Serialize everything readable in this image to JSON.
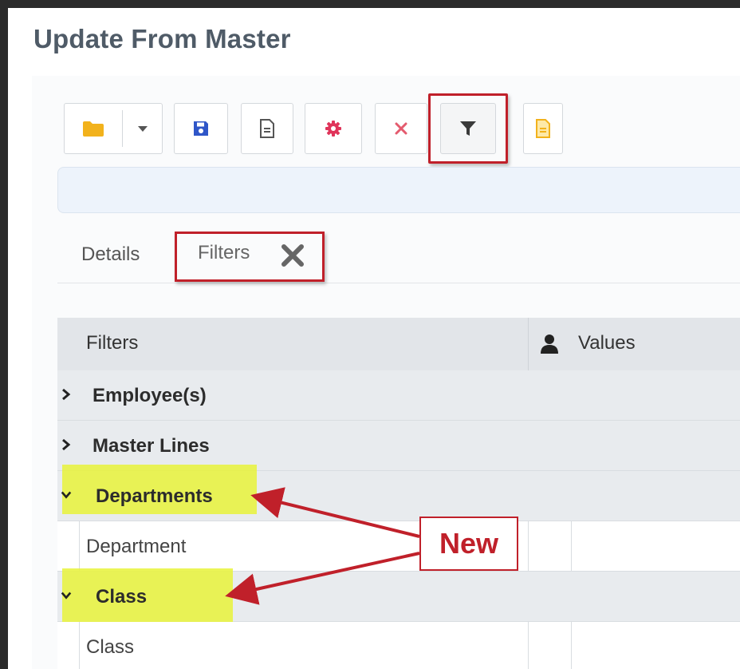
{
  "page": {
    "title": "Update From Master"
  },
  "toolbar": {
    "buttons": [
      {
        "name": "open-folder",
        "icon": "folder-icon",
        "color": "#f2b21c"
      },
      {
        "name": "dropdown",
        "icon": "caret-down-icon",
        "color": "#555555"
      },
      {
        "name": "save",
        "icon": "save-icon",
        "color": "#2f56c8"
      },
      {
        "name": "document",
        "icon": "document-icon",
        "color": "#555555"
      },
      {
        "name": "settings",
        "icon": "gear-icon",
        "color": "#e0345a"
      },
      {
        "name": "delete",
        "icon": "close-icon",
        "color": "#e45b6e"
      },
      {
        "name": "filter",
        "icon": "filter-icon",
        "color": "#3a3a3a"
      },
      {
        "name": "report",
        "icon": "report-icon",
        "color": "#f2b21c"
      }
    ]
  },
  "tabs": {
    "details": "Details",
    "filters": "Filters"
  },
  "grid": {
    "headers": {
      "filters": "Filters",
      "values": "Values"
    },
    "rows": [
      {
        "type": "group",
        "label": "Employee(s)",
        "expanded": false
      },
      {
        "type": "group",
        "label": "Master Lines",
        "expanded": false
      },
      {
        "type": "group",
        "label": "Departments",
        "expanded": true
      },
      {
        "type": "item",
        "label": "Department"
      },
      {
        "type": "group",
        "label": "Class",
        "expanded": true
      },
      {
        "type": "item",
        "label": "Class"
      }
    ]
  },
  "annotation": {
    "text": "New",
    "color": "#c0202a",
    "highlight": "#e8f33a"
  }
}
